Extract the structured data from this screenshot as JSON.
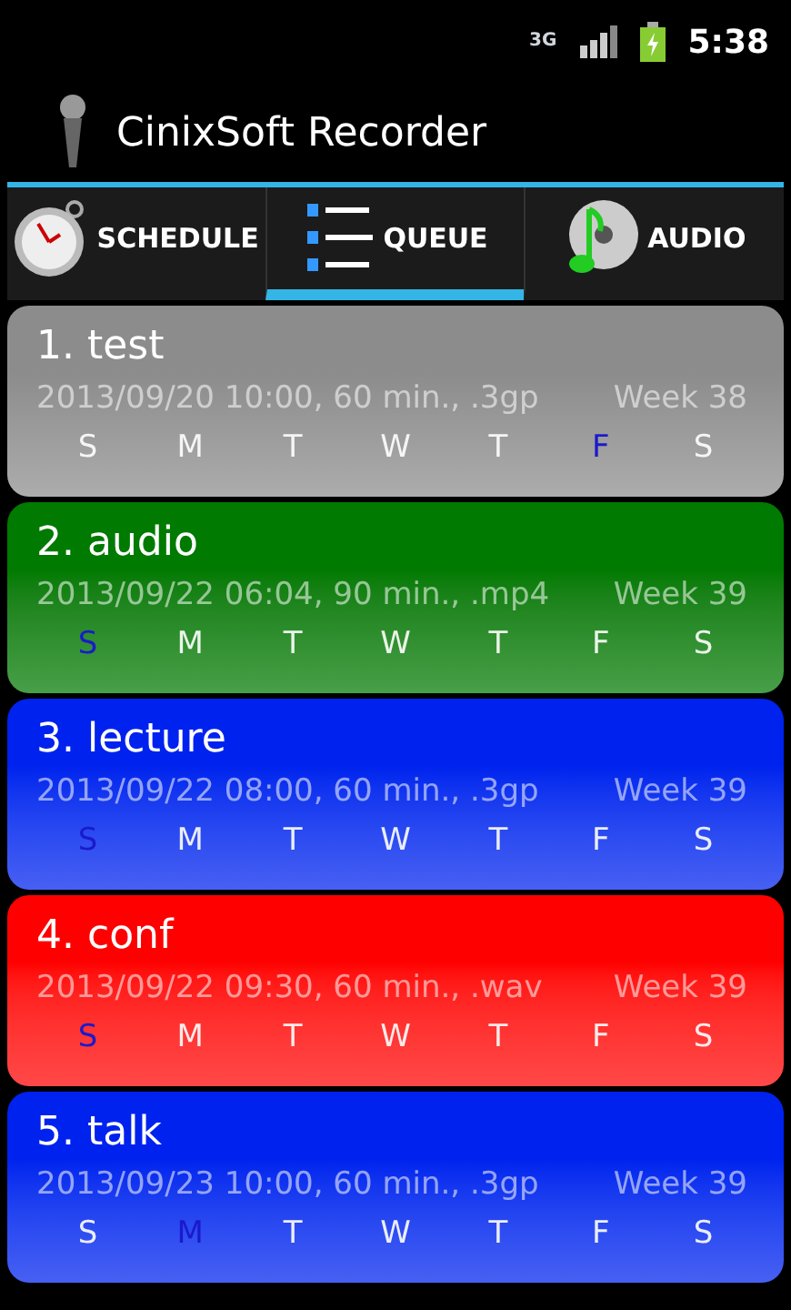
{
  "status_bar": {
    "network": "3G",
    "time": "5:38"
  },
  "app_bar": {
    "title": "CinixSoft Recorder"
  },
  "tabs": [
    {
      "label": "SCHEDULE",
      "kind": "clock",
      "selected": false
    },
    {
      "label": "QUEUE",
      "kind": "list",
      "selected": true
    },
    {
      "label": "AUDIO",
      "kind": "disc",
      "selected": false
    }
  ],
  "recordings": [
    {
      "title": "1. test",
      "details": "2013/09/20 10:00, 60 min., .3gp",
      "week": "Week 38",
      "color": "#8c8c8c",
      "days": [
        {
          "label": "S",
          "selected": false
        },
        {
          "label": "M",
          "selected": false
        },
        {
          "label": "T",
          "selected": false
        },
        {
          "label": "W",
          "selected": false
        },
        {
          "label": "T",
          "selected": false
        },
        {
          "label": "F",
          "selected": true
        },
        {
          "label": "S",
          "selected": false
        }
      ]
    },
    {
      "title": "2. audio",
      "details": "2013/09/22 06:04, 90 min., .mp4",
      "week": "Week 39",
      "color": "#007a00",
      "days": [
        {
          "label": "S",
          "selected": true
        },
        {
          "label": "M",
          "selected": false
        },
        {
          "label": "T",
          "selected": false
        },
        {
          "label": "W",
          "selected": false
        },
        {
          "label": "T",
          "selected": false
        },
        {
          "label": "F",
          "selected": false
        },
        {
          "label": "S",
          "selected": false
        }
      ]
    },
    {
      "title": "3. lecture",
      "details": "2013/09/22 08:00, 60 min., .3gp",
      "week": "Week 39",
      "color": "#0022ee",
      "days": [
        {
          "label": "S",
          "selected": true
        },
        {
          "label": "M",
          "selected": false
        },
        {
          "label": "T",
          "selected": false
        },
        {
          "label": "W",
          "selected": false
        },
        {
          "label": "T",
          "selected": false
        },
        {
          "label": "F",
          "selected": false
        },
        {
          "label": "S",
          "selected": false
        }
      ]
    },
    {
      "title": "4. conf",
      "details": "2013/09/22 09:30, 60 min., .wav",
      "week": "Week 39",
      "color": "#ff0000",
      "days": [
        {
          "label": "S",
          "selected": true
        },
        {
          "label": "M",
          "selected": false
        },
        {
          "label": "T",
          "selected": false
        },
        {
          "label": "W",
          "selected": false
        },
        {
          "label": "T",
          "selected": false
        },
        {
          "label": "F",
          "selected": false
        },
        {
          "label": "S",
          "selected": false
        }
      ]
    },
    {
      "title": "5. talk",
      "details": "2013/09/23 10:00, 60 min., .3gp",
      "week": "Week 39",
      "color": "#0022ee",
      "days": [
        {
          "label": "S",
          "selected": false
        },
        {
          "label": "M",
          "selected": true
        },
        {
          "label": "T",
          "selected": false
        },
        {
          "label": "W",
          "selected": false
        },
        {
          "label": "T",
          "selected": false
        },
        {
          "label": "F",
          "selected": false
        },
        {
          "label": "S",
          "selected": false
        }
      ]
    }
  ]
}
